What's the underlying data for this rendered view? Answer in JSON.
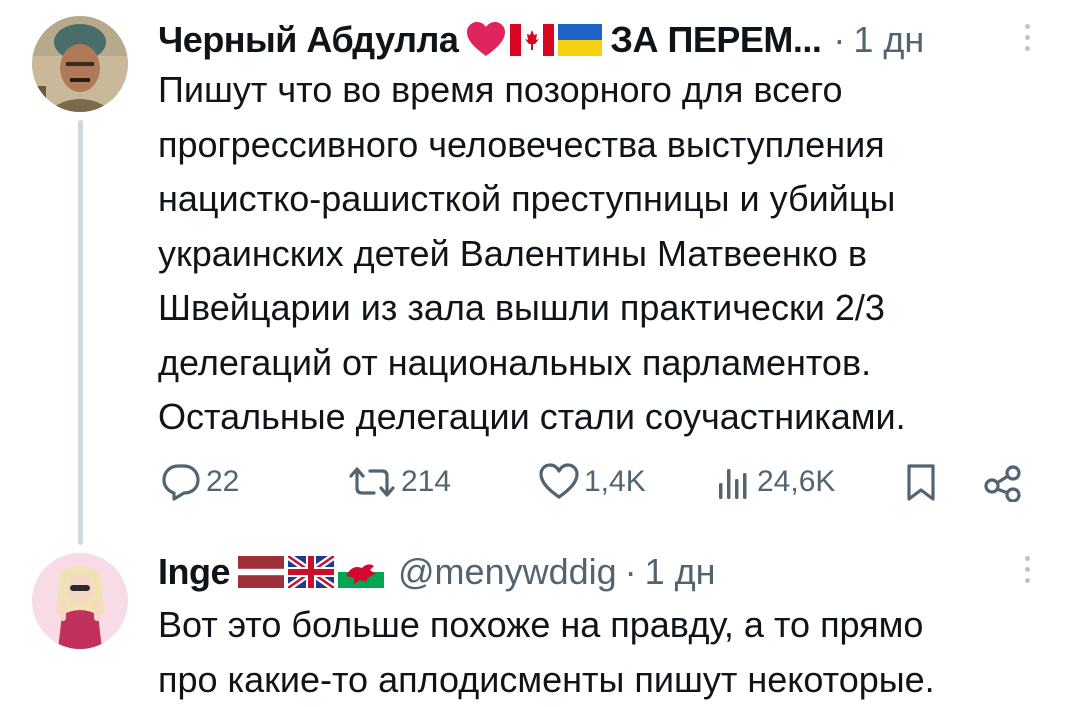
{
  "thread": {
    "tweet1": {
      "author_name": "Черный Абдулла",
      "author_suffix": "ЗА ПЕРЕМ...",
      "separator": "·",
      "time": "1 дн",
      "flags": [
        "heart-icon",
        "canada-flag-icon",
        "ukraine-flag-icon"
      ],
      "text": "Пишут что во время позорного для всего\nпрогрессивного человечества выступления\nнацистко-рашисткой преступницы и убийцы\nукраинских детей Валентины Матвеенко в\nШвейцарии из зала вышли практически 2/3\nделегаций от национальных парламентов.\nОстальные делегации стали соучастниками.",
      "actions": {
        "replies": "22",
        "retweets": "214",
        "likes": "1,4K",
        "views": "24,6K"
      }
    },
    "tweet2": {
      "author_name": "Inge",
      "handle": "@menywddig",
      "separator": "·",
      "time": "1 дн",
      "flags": [
        "latvia-flag-icon",
        "uk-flag-icon",
        "wales-flag-icon"
      ],
      "text": "Вот это больше похоже на правду, а то прямо\nпро какие-то аплодисменты пишут некоторые."
    }
  },
  "colors": {
    "text": "#0f1419",
    "secondary": "#536471",
    "thread_line": "#cfd9de",
    "heart": "#f91880"
  }
}
